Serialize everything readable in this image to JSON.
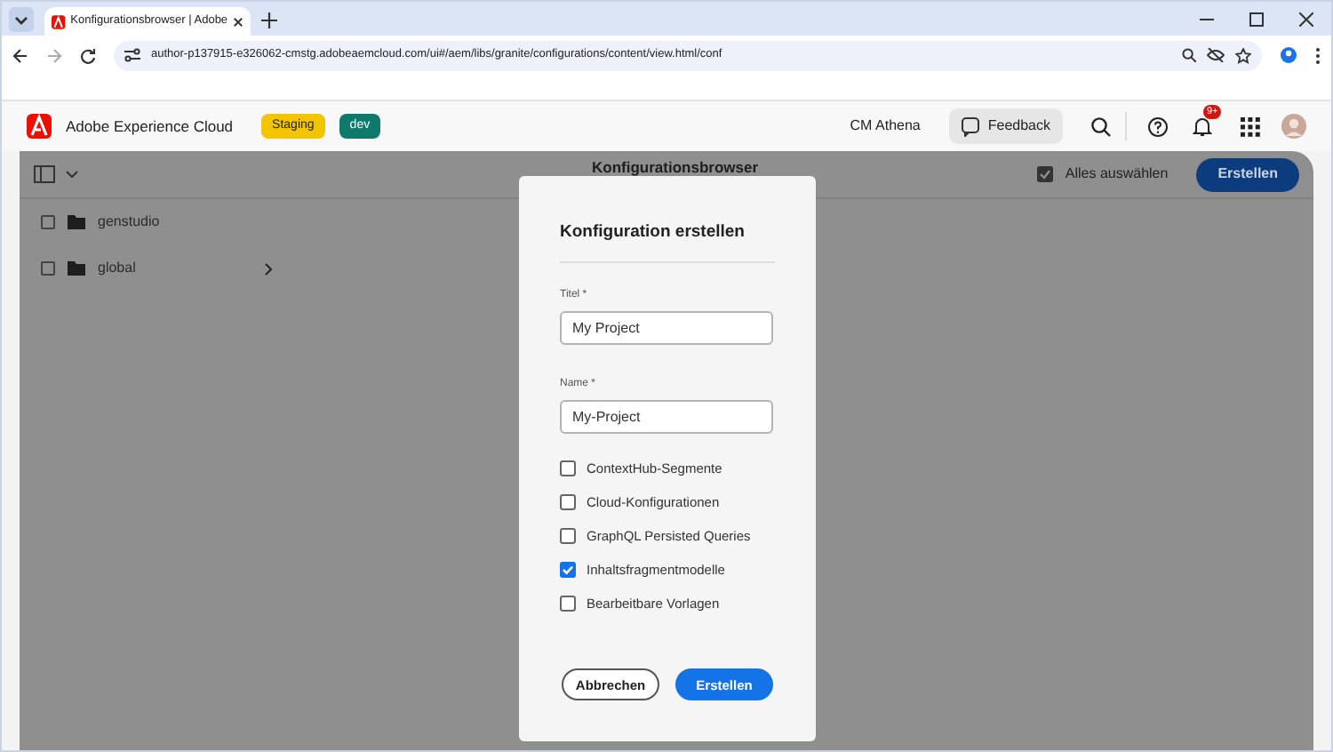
{
  "browser": {
    "tab_title": "Konfigurationsbrowser | Adobe",
    "url": "author-p137915-e326062-cmstg.adobeaemcloud.com/ui#/aem/libs/granite/configurations/content/view.html/conf"
  },
  "header": {
    "product": "Adobe Experience Cloud",
    "badges": [
      {
        "label": "Staging",
        "color": "#f2c500"
      },
      {
        "label": "dev",
        "color": "#0f7a6b"
      }
    ],
    "org": "CM Athena",
    "feedback": "Feedback",
    "notification_count": "9+"
  },
  "toolbar": {
    "title": "Konfigurationsbrowser",
    "select_all": "Alles auswählen",
    "create": "Erstellen"
  },
  "items": [
    {
      "name": "genstudio",
      "checked": false,
      "has_children": false
    },
    {
      "name": "global",
      "checked": false,
      "has_children": true
    }
  ],
  "dialog": {
    "title": "Konfiguration erstellen",
    "fields": [
      {
        "label": "Titel *",
        "value": "My Project"
      },
      {
        "label": "Name *",
        "value": "My-Project"
      }
    ],
    "options": [
      {
        "label": "ContextHub-Segmente",
        "checked": false
      },
      {
        "label": "Cloud-Konfigurationen",
        "checked": false
      },
      {
        "label": "GraphQL Persisted Queries",
        "checked": false
      },
      {
        "label": "Inhaltsfragmentmodelle",
        "checked": true
      },
      {
        "label": "Bearbeitbare Vorlagen",
        "checked": false
      }
    ],
    "buttons": [
      {
        "label": "Abbrechen",
        "kind": "secondary"
      },
      {
        "label": "Erstellen",
        "kind": "primary"
      }
    ]
  }
}
